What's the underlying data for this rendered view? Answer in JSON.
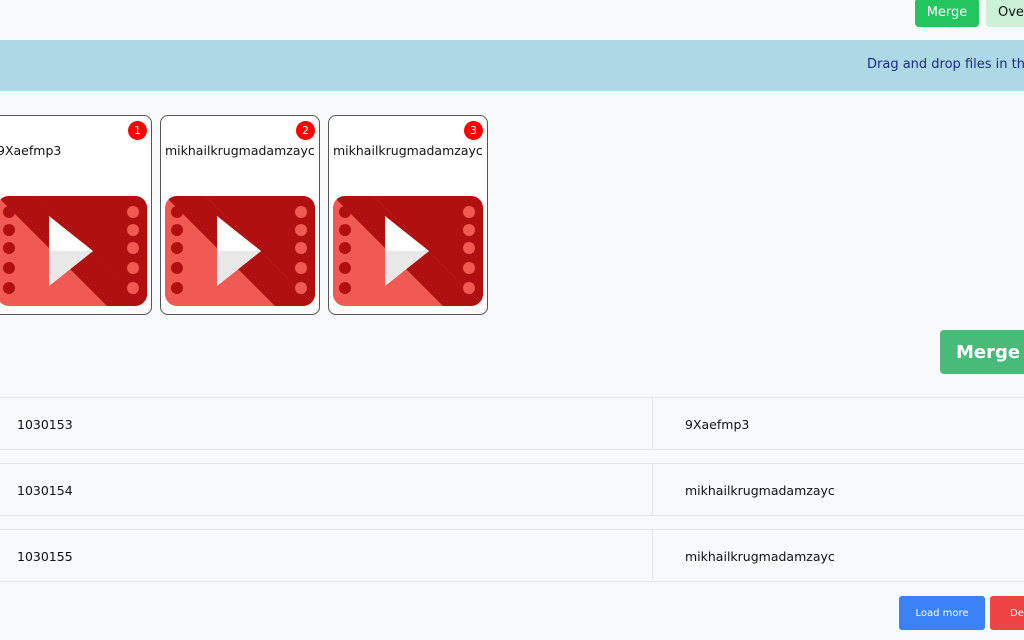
{
  "toolbar": {
    "merge_label": "Merge",
    "over_label": "Over"
  },
  "banner": {
    "text": "Drag and drop files in the o"
  },
  "cards": [
    {
      "name": "9Xaefmp3",
      "order": "1"
    },
    {
      "name": "mikhailkrugmadamzayc",
      "order": "2"
    },
    {
      "name": "mikhailkrugmadamzayc",
      "order": "3"
    }
  ],
  "merge_big_label": "Merge",
  "table": {
    "rows": [
      {
        "id": "1030153",
        "name": "9Xaefmp3"
      },
      {
        "id": "1030154",
        "name": "mikhailkrugmadamzayc"
      },
      {
        "id": "1030155",
        "name": "mikhailkrugmadamzayc"
      }
    ]
  },
  "footer": {
    "load_more_label": "Load more",
    "delete_label": "Del"
  },
  "colors": {
    "banner": "#add8e6",
    "merge": "#22c55e",
    "badge": "#ff0000",
    "video_dark": "#b01010",
    "video_light": "#f05a52"
  }
}
